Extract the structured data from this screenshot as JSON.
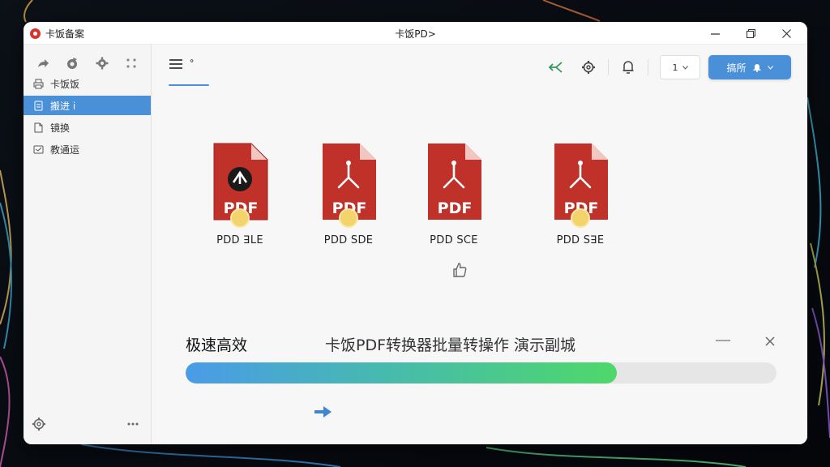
{
  "window": {
    "app_name": "卡饭备案",
    "title": "卡饭PD>"
  },
  "sidebar": {
    "items": [
      {
        "label": "卡饭饭",
        "icon": "printer-icon",
        "active": false
      },
      {
        "label": "搬进 i",
        "icon": "document-icon",
        "active": true
      },
      {
        "label": "镜换",
        "icon": "file-icon",
        "active": false
      },
      {
        "label": "教通运",
        "icon": "image-icon",
        "active": false
      }
    ]
  },
  "toolbar": {
    "menu_label": "ᐤ",
    "page_select": "1",
    "primary_label": "搞所"
  },
  "files": [
    {
      "name": "PDD ꓱLE",
      "icon": "pdf-logo-icon"
    },
    {
      "name": "PDD SDE",
      "icon": "pdf-acrobat-icon"
    },
    {
      "name": "PDD SCE",
      "icon": "pdf-acrobat-icon"
    },
    {
      "name": "PDD SꓱE",
      "icon": "pdf-acrobat-icon"
    }
  ],
  "progress": {
    "title": "极速高效",
    "subtitle": "卡饭PDF转换器批量转操作 演示副城",
    "fraction": 0.73
  },
  "colors": {
    "accent": "#4a90d9",
    "pdf_red": "#c0312a",
    "progress_start": "#4a9be8",
    "progress_end": "#4fd86a"
  }
}
